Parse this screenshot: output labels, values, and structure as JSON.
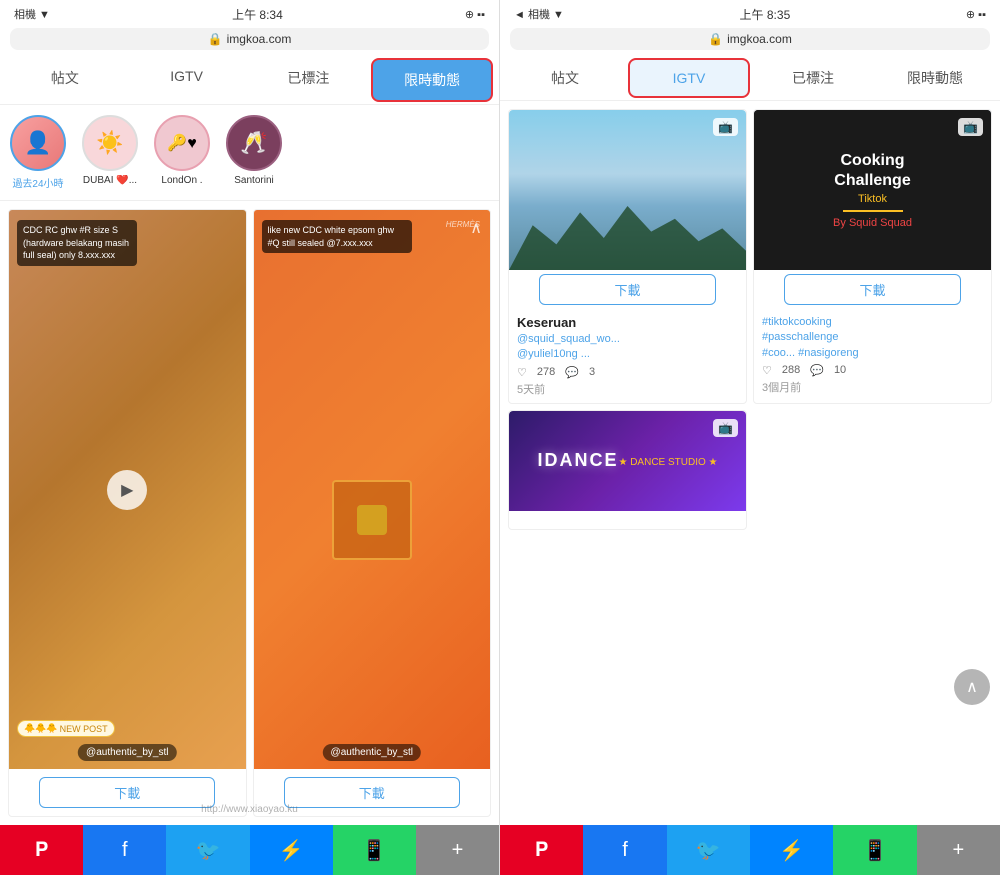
{
  "left_panel": {
    "status": {
      "left": "相機 ▼",
      "time": "上午 8:34",
      "right": "⊕ ▪▪"
    },
    "address": "imgkoa.com",
    "tabs": [
      {
        "label": "帖文",
        "active": false
      },
      {
        "label": "IGTV",
        "active": false
      },
      {
        "label": "已標注",
        "active": false
      },
      {
        "label": "限時動態",
        "active": true
      }
    ],
    "stories": [
      {
        "label": "過去24小時",
        "active": true,
        "type": "photo"
      },
      {
        "label": "DUBAI ❤️...",
        "type": "pink",
        "icon": "☀"
      },
      {
        "label": "LondOn .",
        "type": "rose",
        "icon": "🔑♥"
      },
      {
        "label": "Santorini",
        "type": "wine",
        "icon": "🥂"
      }
    ],
    "posts": [
      {
        "overlay": "CDC RC ghw #R size S (hardware belakang masih full seal) only 8.xxx.xxx",
        "username": "@authentic_by_stl",
        "new_post": "NEW POST",
        "download": "下載"
      },
      {
        "overlay": "like new CDC white epsom ghw #Q still sealed @7.xxx.xxx",
        "username": "@authentic_by_stl",
        "download": "下載"
      }
    ]
  },
  "right_panel": {
    "status": {
      "left": "◄ 相機 ▼",
      "time": "上午 8:35",
      "right": "⊕ ▪▪"
    },
    "address": "imgkoa.com",
    "tabs": [
      {
        "label": "帖文",
        "active": false
      },
      {
        "label": "IGTV",
        "active": true
      },
      {
        "label": "已標注",
        "active": false
      },
      {
        "label": "限時動態",
        "active": false
      }
    ],
    "videos": [
      {
        "title": "Keseruan",
        "subtitle": "@squid_squad_wo...\n@yuliel10ng ...",
        "likes": "278",
        "comments": "3",
        "time": "5天前",
        "download": "下載",
        "thumb_type": "sky"
      },
      {
        "title": "Cooking Challenge",
        "subtitle": "#tiktokcooking\n#passchallenge\n#coo... #nasigoreng",
        "likes": "288",
        "comments": "10",
        "time": "3個月前",
        "download": "下載",
        "thumb_type": "cooking"
      },
      {
        "title": "IDANCE",
        "subtitle": "Dance Studio",
        "likes": "",
        "comments": "",
        "time": "",
        "download": "",
        "thumb_type": "dance"
      }
    ]
  },
  "share_bar": {
    "pinterest": "P",
    "facebook": "f",
    "twitter": "🐦",
    "messenger": "⚡",
    "whatsapp": "📱",
    "more": "+"
  },
  "watermark": "http://www.xiaoyao.ku",
  "colors": {
    "blue": "#4da3e8",
    "red_border": "#e8323a",
    "pinterest": "#e60023",
    "facebook": "#1877f2",
    "twitter": "#1da1f2",
    "messenger": "#0084ff",
    "whatsapp": "#25d366",
    "more": "#888888"
  }
}
